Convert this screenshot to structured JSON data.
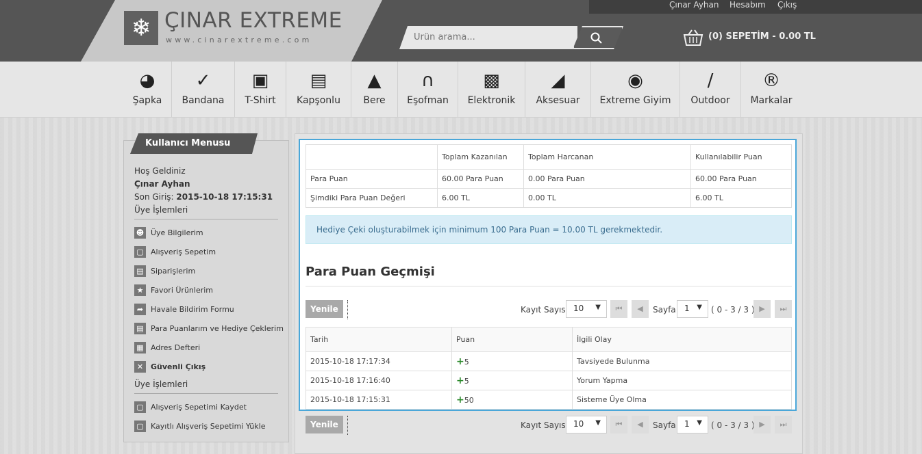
{
  "header": {
    "brand": "ÇINAR EXTREME",
    "url": "www.cinarextreme.com",
    "user_link": "Çınar Ayhan",
    "account_link": "Hesabım",
    "logout_link": "Çıkış",
    "search_placeholder": "Ürün arama...",
    "cart_label": "(0) SEPETİM - 0.00 TL"
  },
  "categories": [
    {
      "label": "Şapka",
      "icon": "cap-icon"
    },
    {
      "label": "Bandana",
      "icon": "bandana-icon"
    },
    {
      "label": "T-Shirt",
      "icon": "tshirt-icon"
    },
    {
      "label": "Kapşonlu",
      "icon": "hoodie-icon"
    },
    {
      "label": "Bere",
      "icon": "beanie-icon"
    },
    {
      "label": "Eşofman",
      "icon": "tracksuit-icon"
    },
    {
      "label": "Elektronik",
      "icon": "computer-icon"
    },
    {
      "label": "Aksesuar",
      "icon": "shoe-icon"
    },
    {
      "label": "Extreme Giyim",
      "icon": "helmet-icon"
    },
    {
      "label": "Outdoor",
      "icon": "knife-icon"
    },
    {
      "label": "Markalar",
      "icon": "registered-icon"
    }
  ],
  "sidebar": {
    "title": "Kullanıcı Menusu",
    "welcome": "Hoş Geldiniz",
    "username": "Çınar Ayhan",
    "last_login_label": "Son Giriş:",
    "last_login_value": "2015-10-18 17:15:31",
    "section1": "Üye İşlemleri",
    "items": [
      {
        "label": "Üye Bilgilerim",
        "icon": "user-icon"
      },
      {
        "label": "Alışveriş Sepetim",
        "icon": "basket-icon"
      },
      {
        "label": "Siparişlerim",
        "icon": "document-icon"
      },
      {
        "label": "Favori Ürünlerim",
        "icon": "star-icon"
      },
      {
        "label": "Havale Bildirim Formu",
        "icon": "share-icon"
      },
      {
        "label": "Para Puanlarım ve Hediye Çeklerim",
        "icon": "document-icon"
      },
      {
        "label": "Adres Defteri",
        "icon": "address-card-icon"
      },
      {
        "label": "Güvenli Çıkış",
        "icon": "close-icon"
      }
    ],
    "section2": "Üye İşlemleri",
    "items2": [
      {
        "label": "Alışveriş Sepetimi Kaydet",
        "icon": "basket-icon"
      },
      {
        "label": "Kayıtlı Alışveriş Sepetimi Yükle",
        "icon": "basket-icon"
      }
    ]
  },
  "points_table": {
    "headers": [
      "",
      "Toplam Kazanılan",
      "Toplam Harcanan",
      "Kullanılabilir Puan"
    ],
    "rows": [
      [
        "Para Puan",
        "60.00 Para Puan",
        "0.00 Para Puan",
        "60.00 Para Puan"
      ],
      [
        "Şimdiki Para Puan Değeri",
        "6.00 TL",
        "0.00 TL",
        "6.00 TL"
      ]
    ]
  },
  "info_text": "Hediye Çeki oluşturabilmek için minimum 100 Para Puan = 10.00 TL gerekmektedir.",
  "history_title": "Para Puan Geçmişi",
  "pager": {
    "refresh": "Yenile",
    "records_label": "Kayıt Sayısı",
    "records_value": "10",
    "page_label": "Sayfa",
    "page_value": "1",
    "range": "( 0 - 3 / 3 )"
  },
  "history_table": {
    "headers": [
      "Tarih",
      "Puan",
      "İlgili Olay"
    ],
    "rows": [
      [
        "2015-10-18 17:17:34",
        "5",
        "Tavsiyede Bulunma"
      ],
      [
        "2015-10-18 17:16:40",
        "5",
        "Yorum Yapma"
      ],
      [
        "2015-10-18 17:15:31",
        "50",
        "Sisteme Üye Olma"
      ]
    ]
  }
}
